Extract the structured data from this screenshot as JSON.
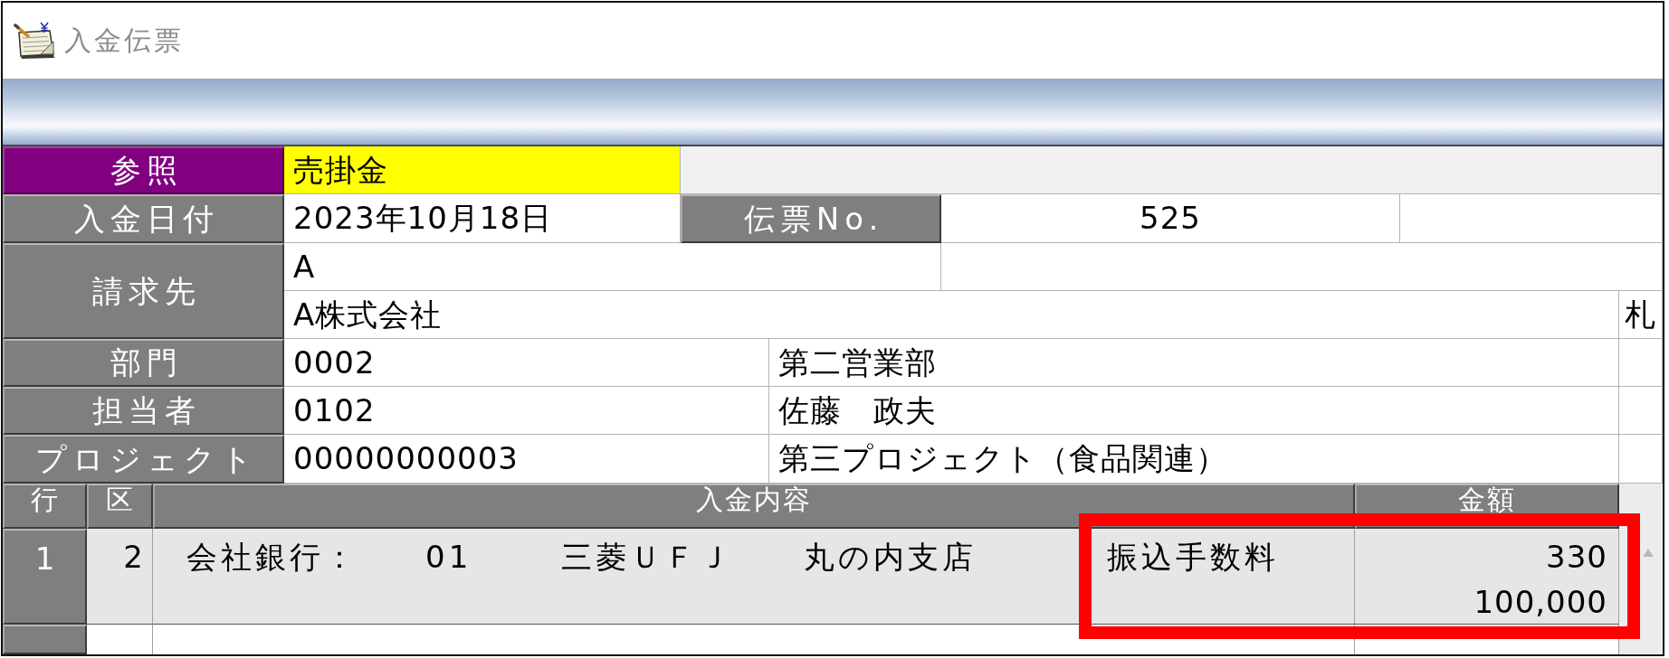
{
  "window": {
    "title": "入金伝票"
  },
  "form": {
    "reference": {
      "label": "参照",
      "value": "売掛金"
    },
    "date": {
      "label": "入金日付",
      "value": "2023年10月18日"
    },
    "slip_no": {
      "label": "伝票No.",
      "value": "525"
    },
    "billing": {
      "label": "請求先",
      "code": "A",
      "name": "A株式会社",
      "column_3": "札"
    },
    "rows": [
      {
        "label": "部門",
        "code": "0002",
        "name": "第二営業部"
      },
      {
        "label": "担当者",
        "code": "0102",
        "name": "佐藤　政夫"
      },
      {
        "label": "プロジェクト",
        "code": "00000000003",
        "name": "第三プロジェクト（食品関連）"
      }
    ]
  },
  "table": {
    "columns": [
      "行",
      "区",
      "入金内容",
      "金額"
    ],
    "rows": [
      {
        "row": "1",
        "category": "2",
        "bank_label": "会社銀行：",
        "bank_code": "01",
        "bank_name": "三菱ＵＦＪ",
        "branch": "丸の内支店",
        "item": "振込手数料",
        "amounts": [
          "330",
          "100,000"
        ]
      }
    ]
  },
  "annotation": {
    "kind": "frame"
  }
}
